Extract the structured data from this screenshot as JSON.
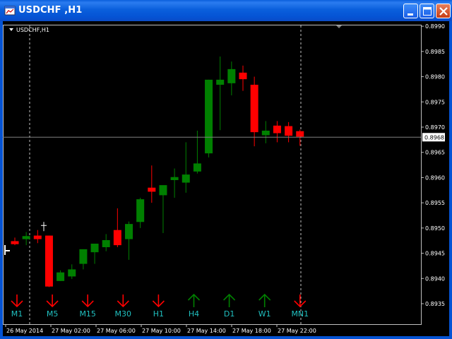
{
  "window": {
    "title": "USDCHF ,H1",
    "chart_label": "USDCHF,H1",
    "colors": {
      "titlebar": "#0a5fdc",
      "background": "#000000",
      "bull": "#008000",
      "bear": "#ff0000",
      "axis_text": "#ffffff",
      "timeframe_label": "#20c0c0",
      "up_arrow": "#008000",
      "down_arrow": "#ff0000",
      "bid_line": "#808080"
    },
    "icons": {
      "app": "chart-window-icon",
      "minimize": "minimize-icon",
      "maximize": "maximize-icon",
      "close": "close-icon",
      "menu": "triangle-down-icon"
    }
  },
  "chart_data": {
    "type": "candlestick",
    "symbol": "USDCHF",
    "timeframe": "H1",
    "current_price": "0.8968",
    "price_ticks": [
      "0.8990",
      "0.8985",
      "0.8980",
      "0.8975",
      "0.8970",
      "0.8965",
      "0.8960",
      "0.8955",
      "0.8950",
      "0.8945",
      "0.8940",
      "0.8935"
    ],
    "ylim": [
      0.89315,
      0.89903
    ],
    "time_labels": [
      "26 May 2014",
      "27 May 02:00",
      "27 May 06:00",
      "27 May 10:00",
      "27 May 14:00",
      "27 May 18:00",
      "27 May 22:00"
    ],
    "grid": false,
    "candles": [
      {
        "o": 0.89474,
        "h": 0.89481,
        "l": 0.89466,
        "c": 0.89468
      },
      {
        "o": 0.89478,
        "h": 0.89492,
        "l": 0.89466,
        "c": 0.89484
      },
      {
        "o": 0.89485,
        "h": 0.89496,
        "l": 0.8947,
        "c": 0.89478
      },
      {
        "o": 0.89485,
        "h": 0.89485,
        "l": 0.89383,
        "c": 0.89384
      },
      {
        "o": 0.89395,
        "h": 0.89416,
        "l": 0.89395,
        "c": 0.89412
      },
      {
        "o": 0.89404,
        "h": 0.89428,
        "l": 0.89399,
        "c": 0.89418
      },
      {
        "o": 0.89429,
        "h": 0.8944,
        "l": 0.89418,
        "c": 0.89458
      },
      {
        "o": 0.89452,
        "h": 0.89468,
        "l": 0.89429,
        "c": 0.89469
      },
      {
        "o": 0.89462,
        "h": 0.89488,
        "l": 0.89454,
        "c": 0.89476
      },
      {
        "o": 0.89496,
        "h": 0.89539,
        "l": 0.89462,
        "c": 0.89466
      },
      {
        "o": 0.89478,
        "h": 0.89513,
        "l": 0.89437,
        "c": 0.89508
      },
      {
        "o": 0.89512,
        "h": 0.8956,
        "l": 0.895,
        "c": 0.89557
      },
      {
        "o": 0.8958,
        "h": 0.89624,
        "l": 0.8955,
        "c": 0.89572
      },
      {
        "o": 0.89565,
        "h": 0.8958,
        "l": 0.8949,
        "c": 0.89585
      },
      {
        "o": 0.89595,
        "h": 0.89618,
        "l": 0.8956,
        "c": 0.89601
      },
      {
        "o": 0.8959,
        "h": 0.8967,
        "l": 0.8957,
        "c": 0.89606
      },
      {
        "o": 0.89612,
        "h": 0.89693,
        "l": 0.89608,
        "c": 0.89628
      },
      {
        "o": 0.89648,
        "h": 0.89794,
        "l": 0.8964,
        "c": 0.89794
      },
      {
        "o": 0.89784,
        "h": 0.8984,
        "l": 0.89694,
        "c": 0.89794
      },
      {
        "o": 0.89787,
        "h": 0.8983,
        "l": 0.89763,
        "c": 0.89815
      },
      {
        "o": 0.89808,
        "h": 0.89822,
        "l": 0.89772,
        "c": 0.89795
      },
      {
        "o": 0.89784,
        "h": 0.898,
        "l": 0.89662,
        "c": 0.8969
      },
      {
        "o": 0.89684,
        "h": 0.89712,
        "l": 0.89668,
        "c": 0.89693
      },
      {
        "o": 0.89703,
        "h": 0.89712,
        "l": 0.8967,
        "c": 0.89688
      },
      {
        "o": 0.89702,
        "h": 0.8971,
        "l": 0.8967,
        "c": 0.89683
      },
      {
        "o": 0.89692,
        "h": 0.89695,
        "l": 0.89663,
        "c": 0.89681
      }
    ],
    "extra_ticks": [
      {
        "price": 0.89505,
        "note": "white tick marker"
      },
      {
        "price": 0.89455,
        "note": "left edge white tick"
      }
    ],
    "timeframe_labels": [
      "M1",
      "M5",
      "M15",
      "M30",
      "H1",
      "H4",
      "D1",
      "W1",
      "MN1"
    ],
    "trend_arrows": [
      "down",
      "down",
      "down",
      "down",
      "down",
      "up",
      "up",
      "up",
      "down"
    ]
  }
}
